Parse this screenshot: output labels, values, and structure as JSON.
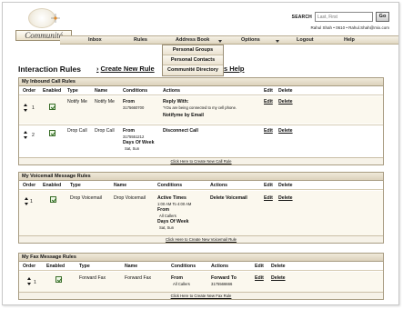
{
  "header": {
    "logo_text": "Communité",
    "search_label": "SEARCH",
    "search_placeholder": "Last, First",
    "go_label": "Go",
    "user_line": "Rahul Shah  •  0610  •  Rahul.Shah@mix.com"
  },
  "nav": {
    "items": [
      "Inbox",
      "Rules",
      "Address Book",
      "Options",
      "Logout",
      "Help"
    ]
  },
  "dropdown": {
    "items": [
      "Personal Groups",
      "Personal Contacts",
      "Communité Directory"
    ]
  },
  "page": {
    "title": "Interaction Rules",
    "new_rule": "Create New Rule",
    "help_suffix": "s Help"
  },
  "inbound": {
    "title": "My Inbound Call Rules",
    "columns": [
      "Order",
      "Enabled",
      "Type",
      "Name",
      "Conditions",
      "Actions",
      "Edit",
      "Delete"
    ],
    "rows": [
      {
        "order": "1",
        "type": "Notify Me",
        "name": "Notify Me",
        "cond_label": "From",
        "cond_value": "3175660700",
        "action1": "Reply With:",
        "action2": "'YOu are being connected to my cell phone.",
        "action3": "Notifyme by Email",
        "edit": "Edit",
        "delete": "Delete"
      },
      {
        "order": "2",
        "type": "Drop Call",
        "name": "Drop Call",
        "cond_label": "From",
        "cond_value": "3175551212",
        "cond_label2": "Days Of Week",
        "cond_value2": "Sat, Sun",
        "action1": "Disconnect Call",
        "edit": "Edit",
        "delete": "Delete"
      }
    ],
    "footer": "Click Here to Create New Call Rule"
  },
  "voicemail": {
    "title": "My Voicemail Message Rules",
    "columns": [
      "Order",
      "Enabled",
      "Type",
      "Name",
      "Conditions",
      "Actions",
      "Edit",
      "Delete"
    ],
    "rows": [
      {
        "order": "1",
        "type": "Drop Voicemail",
        "name": "Drop Voicemail",
        "cond_label": "Active Times",
        "cond_value": "1:00 AM To 4:00 AM",
        "cond_label2": "From",
        "cond_value2": "All Callers",
        "cond_label3": "Days Of Week",
        "cond_value3": "Sat, Sun",
        "action1": "Delete Voicemail",
        "edit": "Edit",
        "delete": "Delete"
      }
    ],
    "footer": "Click Here to Create New Voicemail Rule"
  },
  "fax": {
    "title": "My Fax Message Rules",
    "columns": [
      "Order",
      "Enabled",
      "Type",
      "Name",
      "Conditions",
      "Actions",
      "Edit",
      "Delete"
    ],
    "rows": [
      {
        "order": "1",
        "type": "Forward Fax",
        "name": "Forward Fax",
        "cond_label": "From",
        "cond_value": "All Callers",
        "action1": "Forward To",
        "action2": "3175566666",
        "edit": "Edit",
        "delete": "Delete"
      }
    ],
    "footer": "Click Here to Create New Fax Rule"
  }
}
